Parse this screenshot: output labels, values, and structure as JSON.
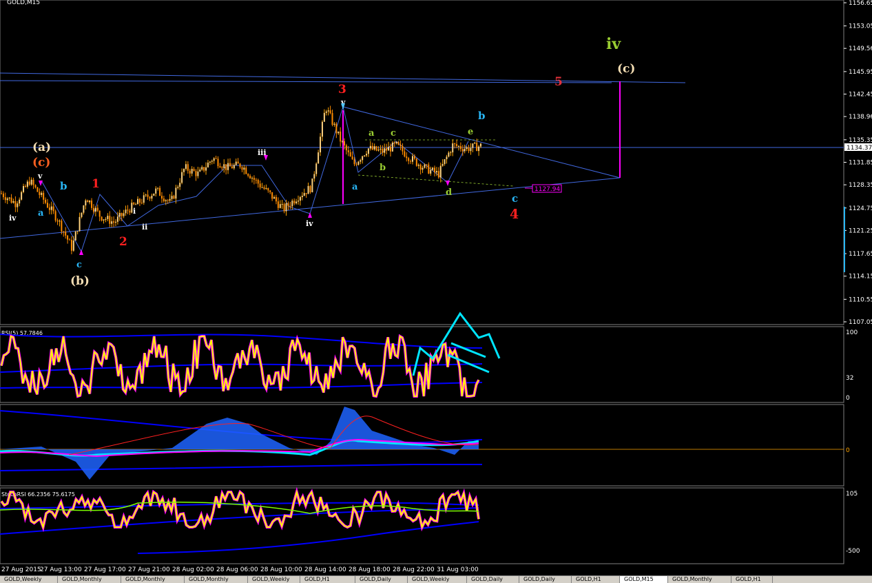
{
  "symbol_label": "GOLD,M15",
  "price_axis": {
    "ticks": [
      "1156.65",
      "1153.05",
      "1149.56",
      "1145.95",
      "1142.45",
      "1138.96",
      "1135.35",
      "1131.85",
      "1128.35",
      "1124.75",
      "1121.25",
      "1117.65",
      "1114.15",
      "1110.55",
      "1107.05"
    ],
    "current_price": "1134.37"
  },
  "time_axis": {
    "labels": [
      "27 Aug 2015",
      "27 Aug 13:00",
      "27 Aug 17:00",
      "27 Aug 21:00",
      "28 Aug 02:00",
      "28 Aug 06:00",
      "28 Aug 10:00",
      "28 Aug 14:00",
      "28 Aug 18:00",
      "28 Aug 22:00",
      "31 Aug 03:00"
    ]
  },
  "indicators": {
    "rsi": {
      "label": "RSI(5) 57.7846",
      "levels": [
        "100",
        "32",
        "0"
      ]
    },
    "macd": {
      "levels": [
        "0"
      ]
    },
    "stochrsi": {
      "label": "StochRSI 66.2356 75.6175",
      "levels": [
        "105",
        "-500"
      ]
    }
  },
  "annotations": {
    "price_box": "1127.94",
    "wave_labels": [
      {
        "text": "iv",
        "color": "#9acd32"
      },
      {
        "text": "(c)",
        "color": "#f5deb3"
      },
      {
        "text": "5",
        "color": "#e0303a"
      },
      {
        "text": "3",
        "color": "#ff2020"
      },
      {
        "text": "v",
        "color": "#ffffff"
      },
      {
        "text": "b",
        "color": "#29b6f6"
      },
      {
        "text": "a",
        "color": "#9acd32"
      },
      {
        "text": "c",
        "color": "#9acd32"
      },
      {
        "text": "e",
        "color": "#9acd32"
      },
      {
        "text": "b",
        "color": "#9acd32"
      },
      {
        "text": "a",
        "color": "#29b6f6"
      },
      {
        "text": "d",
        "color": "#9acd32"
      },
      {
        "text": "c",
        "color": "#29b6f6"
      },
      {
        "text": "4",
        "color": "#ff2020"
      },
      {
        "text": "iii",
        "color": "#ffffff"
      },
      {
        "text": "iv",
        "color": "#ffffff"
      },
      {
        "text": "(a)",
        "color": "#f5deb3"
      },
      {
        "text": "(c)",
        "color": "#ff6020"
      },
      {
        "text": "v",
        "color": "#ffffff"
      },
      {
        "text": "b",
        "color": "#29b6f6"
      },
      {
        "text": "a",
        "color": "#29b6f6"
      },
      {
        "text": "1",
        "color": "#ff2020"
      },
      {
        "text": "2",
        "color": "#ff2020"
      },
      {
        "text": "i",
        "color": "#ffffff"
      },
      {
        "text": "ii",
        "color": "#ffffff"
      },
      {
        "text": "iv",
        "color": "#ffffff"
      },
      {
        "text": "c",
        "color": "#29b6f6"
      },
      {
        "text": "(b)",
        "color": "#f5deb3"
      }
    ]
  },
  "tabs": [
    "GOLD,Weekly",
    "GOLD,Monthly",
    "GOLD,Monthly",
    "GOLD,Monthly",
    "GOLD,Weekly",
    "GOLD,H1",
    "GOLD,Daily",
    "GOLD,Weekly",
    "GOLD,Daily",
    "GOLD,Daily",
    "GOLD,H1",
    "GOLD,M15",
    "GOLD,Monthly",
    "GOLD,H1"
  ],
  "active_tab": "GOLD,M15",
  "colors": {
    "bull_candle": "#ffa500",
    "bear_candle": "#ff8c00",
    "trendline": "#4169e1",
    "magenta": "#ff00ff",
    "cyan": "#00e5ff",
    "rsi_line": "#ffff00",
    "bands": "#0000ff"
  },
  "chart_data": {
    "type": "candlestick",
    "instrument": "GOLD",
    "timeframe": "M15",
    "ylim": [
      1107.05,
      1156.65
    ],
    "x": [
      "27 Aug 2015",
      "27 Aug 13:00",
      "27 Aug 17:00",
      "27 Aug 21:00",
      "28 Aug 02:00",
      "28 Aug 06:00",
      "28 Aug 10:00",
      "28 Aug 14:00",
      "28 Aug 18:00",
      "28 Aug 22:00",
      "31 Aug 03:00"
    ],
    "close_path": [
      1127.0,
      1125.5,
      1129.0,
      1126.0,
      1123.0,
      1118.5,
      1126.5,
      1123.5,
      1122.5,
      1124.5,
      1126.0,
      1127.5,
      1125.5,
      1131.0,
      1130.0,
      1132.5,
      1131.0,
      1131.5,
      1129.0,
      1127.0,
      1124.5,
      1126.5,
      1128.0,
      1140.5,
      1135.5,
      1131.5,
      1134.0,
      1133.5,
      1134.5,
      1132.5,
      1131.0,
      1130.0,
      1134.5,
      1134.0,
      1134.4
    ],
    "current_price": 1134.37,
    "marked_level": 1127.94
  }
}
